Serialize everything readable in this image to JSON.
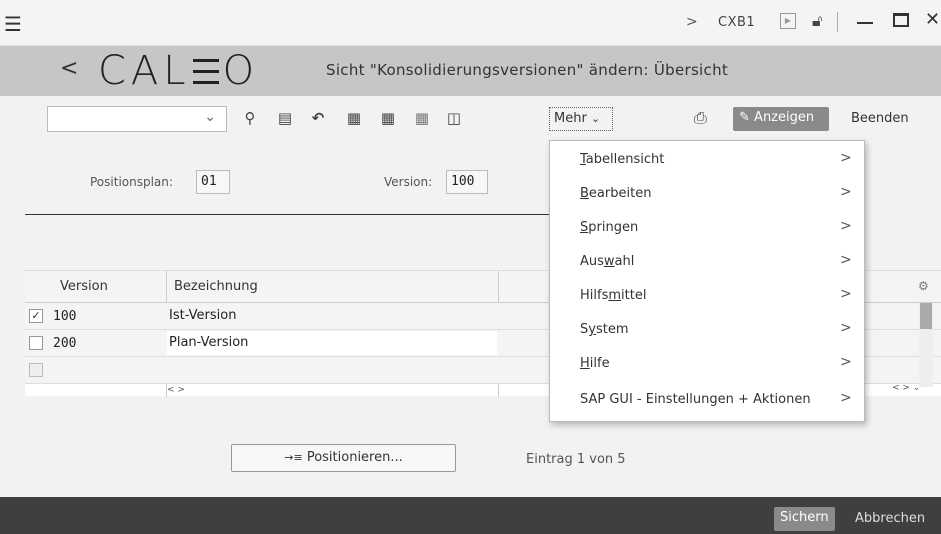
{
  "titlebar": {
    "menu_icon": "hamburger-icon",
    "breadcrumb_chevron": ">",
    "tcode": "CXB1",
    "minimize": "—",
    "close": "✕"
  },
  "header": {
    "back": "<",
    "logo": "CAL☰O",
    "title": "Sicht \"Konsolidierungsversionen\" ändern: Übersicht"
  },
  "toolbar": {
    "combo_value": "",
    "mehr_label": "Mehr",
    "anzeigen_label": "Anzeigen",
    "beenden_label": "Beenden"
  },
  "form": {
    "positionsplan_label": "Positionsplan:",
    "positionsplan_value": "01",
    "version_label": "Version:",
    "version_value": "100"
  },
  "table": {
    "columns": [
      "Version",
      "Bezeichnung"
    ],
    "rows": [
      {
        "version": "100",
        "bezeichnung": "Ist-Version",
        "checked": true
      },
      {
        "version": "200",
        "bezeichnung": "Plan-Version",
        "checked": false
      },
      {
        "version": "",
        "bezeichnung": "",
        "checked": false
      }
    ]
  },
  "bottom": {
    "positionieren_label": "Positionieren...",
    "eintrag_text": "Eintrag 1 von 5"
  },
  "footer": {
    "sichern_label": "Sichern",
    "abbrechen_label": "Abbrechen"
  },
  "menu": {
    "items": [
      {
        "pre": "",
        "u": "T",
        "post": "abellensicht"
      },
      {
        "pre": "",
        "u": "B",
        "post": "earbeiten"
      },
      {
        "pre": "",
        "u": "S",
        "post": "pringen"
      },
      {
        "pre": "Aus",
        "u": "w",
        "post": "ahl"
      },
      {
        "pre": "Hilfs",
        "u": "m",
        "post": "ittel"
      },
      {
        "pre": "S",
        "u": "y",
        "post": "stem"
      },
      {
        "pre": "",
        "u": "H",
        "post": "ilfe"
      },
      {
        "pre": "SAP GUI - Einstellungen + Aktionen",
        "u": "",
        "post": ""
      }
    ]
  }
}
